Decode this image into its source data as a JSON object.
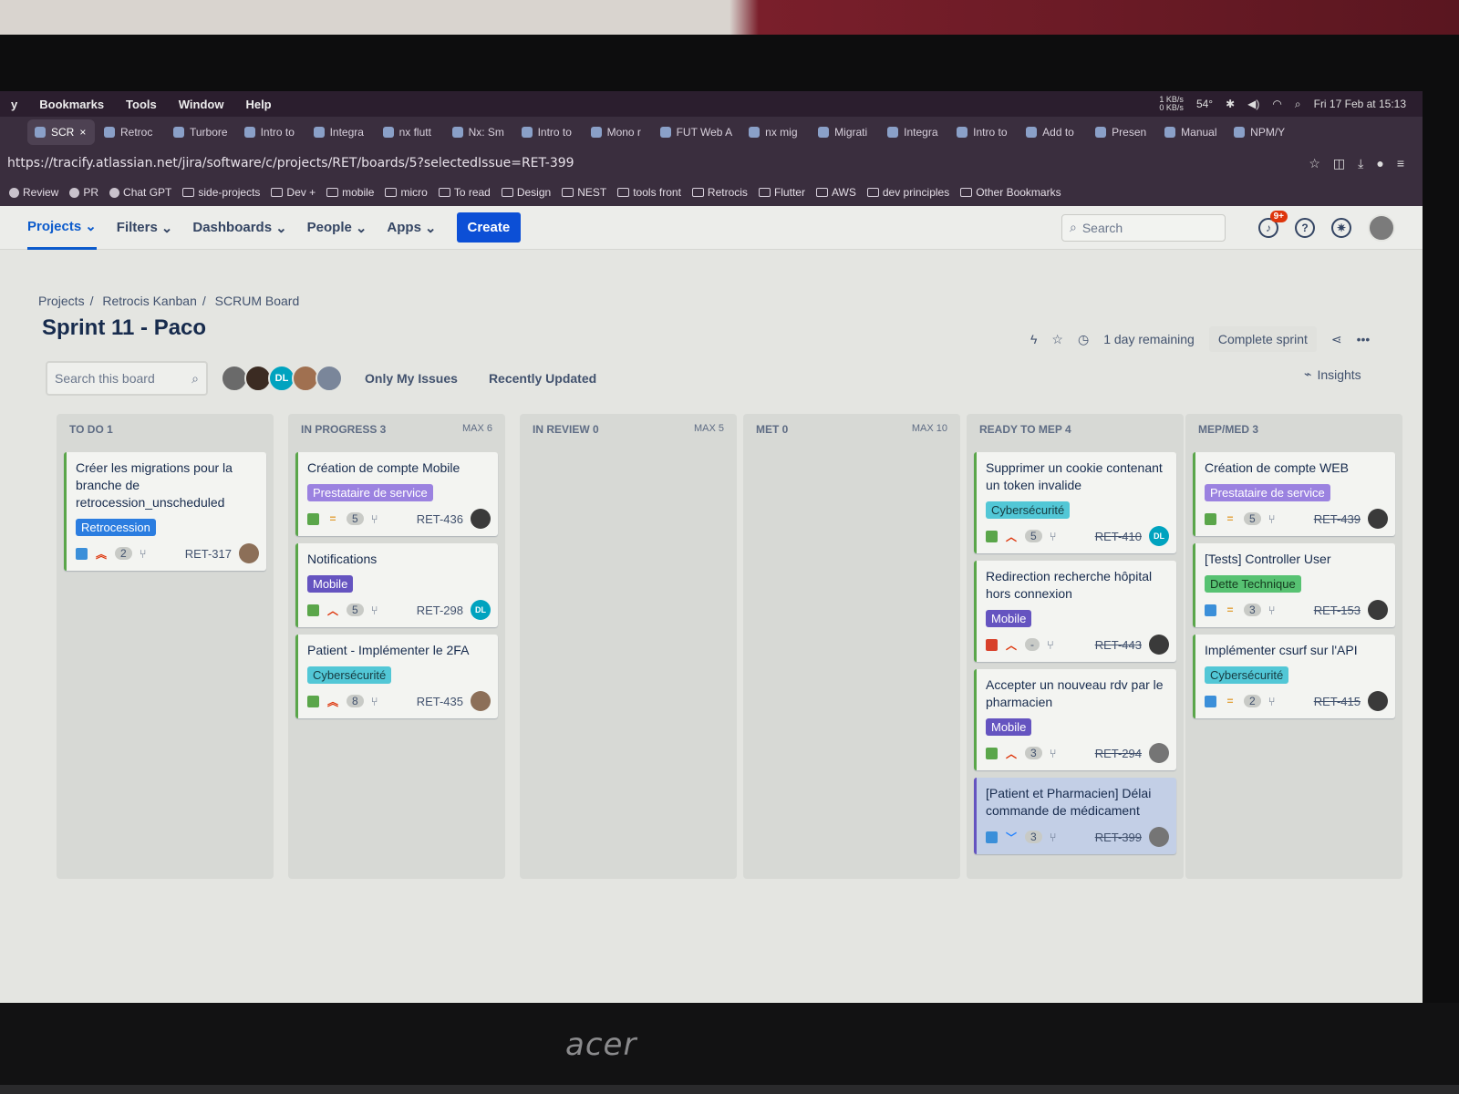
{
  "menubar": {
    "items": [
      "y",
      "Bookmarks",
      "Tools",
      "Window",
      "Help"
    ],
    "net": "1 KB/s\n0 KB/s",
    "temp": "54°",
    "datetime": "Fri 17 Feb at 15:13"
  },
  "tabs": [
    {
      "label": "SCR",
      "active": true
    },
    {
      "label": "Retroc"
    },
    {
      "label": "Turbore"
    },
    {
      "label": "Intro to"
    },
    {
      "label": "Integra"
    },
    {
      "label": "nx flutt"
    },
    {
      "label": "Nx: Sm"
    },
    {
      "label": "Intro to"
    },
    {
      "label": "Mono r"
    },
    {
      "label": "FUT Web A"
    },
    {
      "label": "nx mig"
    },
    {
      "label": "Migrati"
    },
    {
      "label": "Integra"
    },
    {
      "label": "Intro to"
    },
    {
      "label": "Add to"
    },
    {
      "label": "Presen"
    },
    {
      "label": "Manual"
    },
    {
      "label": "NPM/Y"
    }
  ],
  "url": "https://tracify.atlassian.net/jira/software/c/projects/RET/boards/5?selectedIssue=RET-399",
  "bookmarks": [
    {
      "label": "Review",
      "folder": false
    },
    {
      "label": "PR",
      "folder": false
    },
    {
      "label": "Chat GPT",
      "folder": false
    },
    {
      "label": "side-projects",
      "folder": true
    },
    {
      "label": "Dev +",
      "folder": true
    },
    {
      "label": "mobile",
      "folder": true
    },
    {
      "label": "micro",
      "folder": true
    },
    {
      "label": "To read",
      "folder": true
    },
    {
      "label": "Design",
      "folder": true
    },
    {
      "label": "NEST",
      "folder": true
    },
    {
      "label": "tools front",
      "folder": true
    },
    {
      "label": "Retrocis",
      "folder": true
    },
    {
      "label": "Flutter",
      "folder": true
    },
    {
      "label": "AWS",
      "folder": true
    },
    {
      "label": "dev principles",
      "folder": true
    },
    {
      "label": "Other Bookmarks",
      "folder": true
    }
  ],
  "nav": {
    "projects": "Projects",
    "filters": "Filters",
    "dashboards": "Dashboards",
    "people": "People",
    "apps": "Apps",
    "create": "Create",
    "search_placeholder": "Search",
    "notif_badge": "9+"
  },
  "breadcrumb": [
    "Projects",
    "Retrocis Kanban",
    "SCRUM Board"
  ],
  "sprint": {
    "title": "Sprint 11 - Paco",
    "remaining": "1 day remaining",
    "complete": "Complete sprint"
  },
  "board": {
    "search_placeholder": "Search this board",
    "only_my_issues": "Only My Issues",
    "recently_updated": "Recently Updated",
    "insights": "Insights",
    "avatar_initials": "DL"
  },
  "columns": [
    {
      "name": "TO DO 1",
      "max": "",
      "cards": [
        {
          "title": "Créer les migrations pour la branche de retrocession_unscheduled",
          "label": "Retrocession",
          "label_class": "lbl-blue",
          "type": "task",
          "prio": "highest",
          "points": "2",
          "key": "RET-317",
          "done": false,
          "avatar": "photo"
        }
      ]
    },
    {
      "name": "IN PROGRESS 3",
      "max": "Max 6",
      "cards": [
        {
          "title": "Création de compte Mobile",
          "label": "Prestataire de service",
          "label_class": "lbl-purple",
          "type": "story",
          "prio": "medium",
          "points": "5",
          "key": "RET-436",
          "done": false,
          "avatar": "dark"
        },
        {
          "title": "Notifications",
          "label": "Mobile",
          "label_class": "lbl-indigo",
          "type": "story",
          "prio": "high",
          "points": "5",
          "key": "RET-298",
          "done": false,
          "avatar": "DL"
        },
        {
          "title": "Patient - Implémenter le 2FA",
          "label": "Cybersécurité",
          "label_class": "lbl-teal",
          "type": "story",
          "prio": "highest",
          "points": "8",
          "key": "RET-435",
          "done": false,
          "avatar": "photo"
        }
      ]
    },
    {
      "name": "IN REVIEW 0",
      "max": "Max 5",
      "cards": []
    },
    {
      "name": "MET 0",
      "max": "Max 10",
      "cards": []
    },
    {
      "name": "READY TO MEP 4",
      "max": "",
      "cards": [
        {
          "title": "Supprimer un cookie contenant un token invalide",
          "label": "Cybersécurité",
          "label_class": "lbl-teal",
          "type": "story",
          "prio": "high",
          "points": "5",
          "key": "RET-410",
          "done": true,
          "avatar": "DL"
        },
        {
          "title": "Redirection recherche hôpital hors connexion",
          "label": "Mobile",
          "label_class": "lbl-indigo",
          "type": "bug",
          "prio": "high",
          "points": "-",
          "key": "RET-443",
          "done": true,
          "avatar": "dark"
        },
        {
          "title": "Accepter un nouveau rdv par le pharmacien",
          "label": "Mobile",
          "label_class": "lbl-indigo",
          "type": "story",
          "prio": "high",
          "points": "3",
          "key": "RET-294",
          "done": true,
          "avatar": "grey"
        },
        {
          "title": "[Patient et Pharmacien] Délai commande de médicament",
          "label": "",
          "label_class": "",
          "type": "task",
          "prio": "low",
          "points": "3",
          "key": "RET-399",
          "done": true,
          "avatar": "grey",
          "selected": true
        }
      ]
    },
    {
      "name": "MEP/MED 3",
      "max": "",
      "cards": [
        {
          "title": "Création de compte WEB",
          "label": "Prestataire de service",
          "label_class": "lbl-purple",
          "type": "story",
          "prio": "medium",
          "points": "5",
          "key": "RET-439",
          "done": true,
          "avatar": "dark"
        },
        {
          "title": "[Tests] Controller User",
          "label": "Dette Technique",
          "label_class": "lbl-green",
          "type": "task",
          "prio": "medium",
          "points": "3",
          "key": "RET-153",
          "done": true,
          "avatar": "dark"
        },
        {
          "title": "Implémenter csurf sur l'API",
          "label": "Cybersécurité",
          "label_class": "lbl-teal",
          "type": "task",
          "prio": "medium",
          "points": "2",
          "key": "RET-415",
          "done": true,
          "avatar": "dark"
        }
      ]
    }
  ],
  "brand": "acer",
  "colors": {
    "accent": "#0c4fd6",
    "nav_active": "#0c5bcc"
  }
}
